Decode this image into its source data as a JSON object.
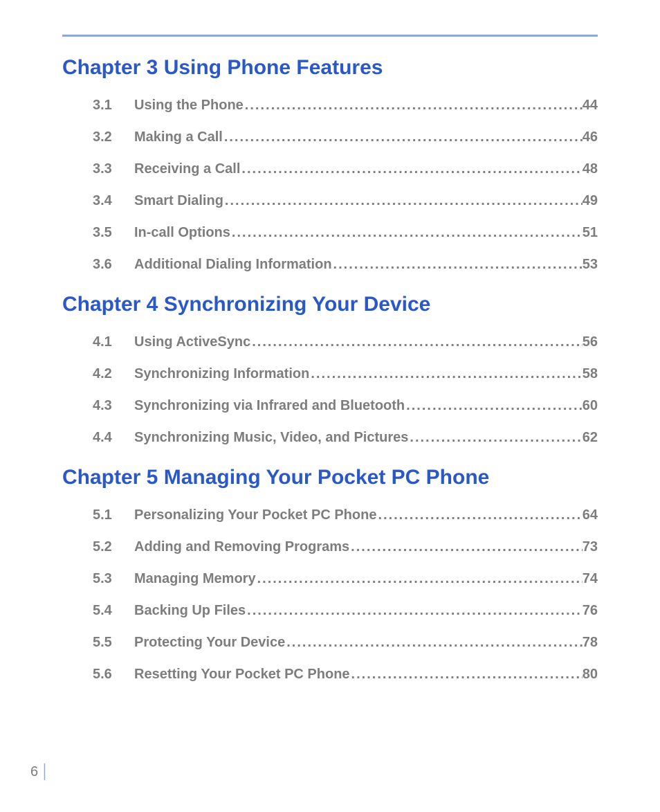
{
  "page_number": "6",
  "chapters": [
    {
      "title": "Chapter 3  Using Phone Features",
      "sections": [
        {
          "num": "3.1",
          "label": "Using the Phone",
          "page": "44"
        },
        {
          "num": "3.2",
          "label": "Making a Call",
          "page": "46"
        },
        {
          "num": "3.3",
          "label": "Receiving a Call",
          "page": "48"
        },
        {
          "num": "3.4",
          "label": "Smart Dialing",
          "page": "49"
        },
        {
          "num": "3.5",
          "label": "In-call Options",
          "page": "51"
        },
        {
          "num": "3.6",
          "label": "Additional Dialing Information",
          "page": "53"
        }
      ]
    },
    {
      "title": "Chapter 4  Synchronizing Your Device",
      "sections": [
        {
          "num": "4.1",
          "label": "Using ActiveSync",
          "page": "56"
        },
        {
          "num": "4.2",
          "label": "Synchronizing Information",
          "page": "58"
        },
        {
          "num": "4.3",
          "label": "Synchronizing via Infrared and Bluetooth",
          "page": "60"
        },
        {
          "num": "4.4",
          "label": "Synchronizing Music, Video, and Pictures",
          "page": "62"
        }
      ]
    },
    {
      "title": "Chapter 5  Managing Your Pocket PC Phone",
      "sections": [
        {
          "num": "5.1",
          "label": "Personalizing Your Pocket PC Phone",
          "page": "64"
        },
        {
          "num": "5.2",
          "label": "Adding and Removing Programs",
          "page": "73"
        },
        {
          "num": "5.3",
          "label": "Managing Memory",
          "page": "74"
        },
        {
          "num": "5.4",
          "label": "Backing Up Files",
          "page": "76"
        },
        {
          "num": "5.5",
          "label": "Protecting Your Device",
          "page": "78"
        },
        {
          "num": "5.6",
          "label": "Resetting Your Pocket PC Phone",
          "page": "80"
        }
      ]
    }
  ]
}
